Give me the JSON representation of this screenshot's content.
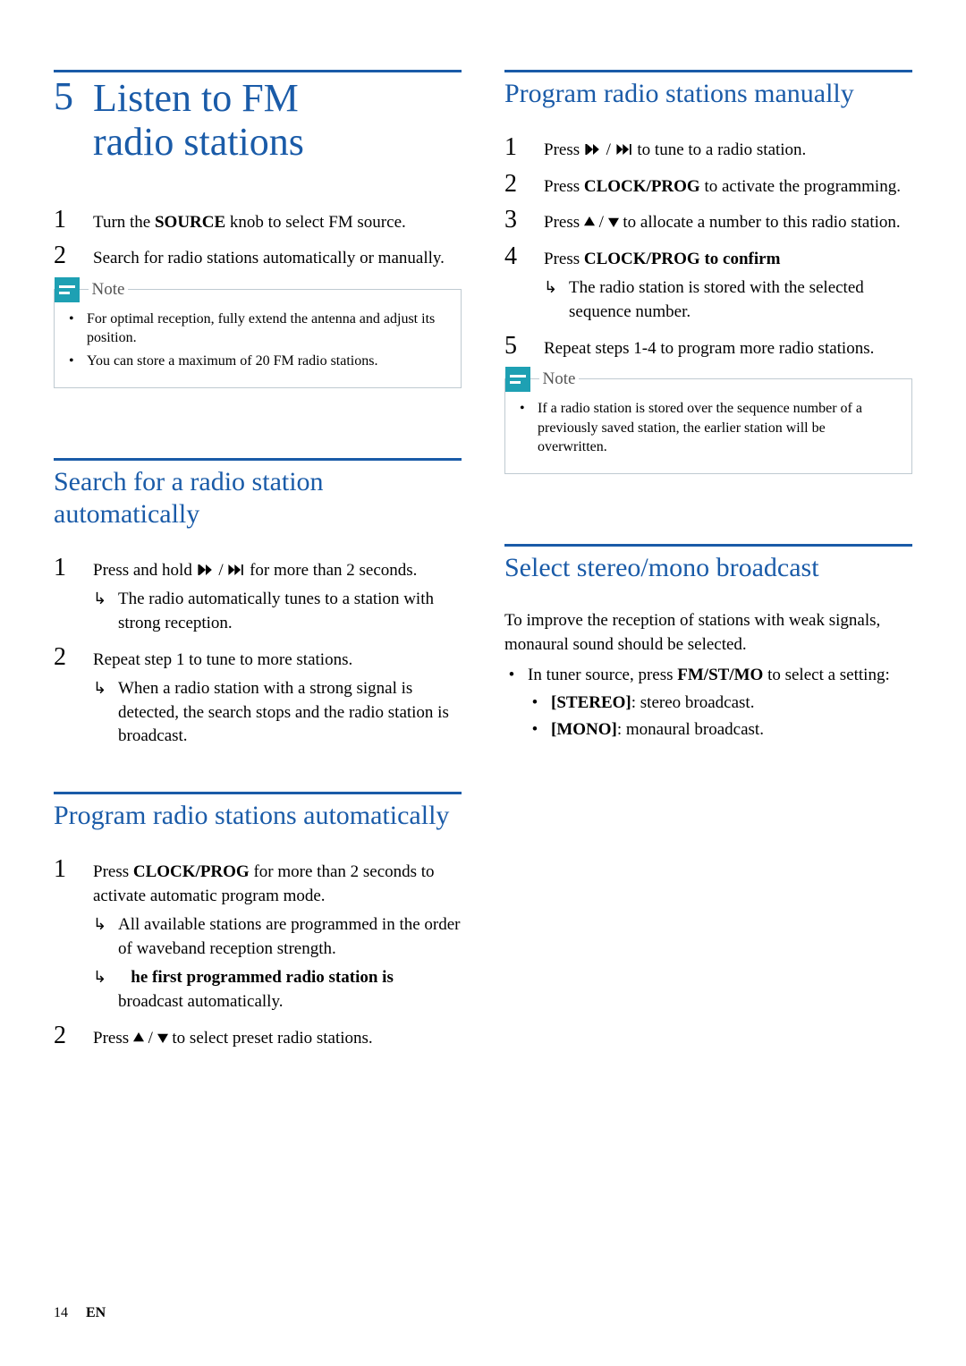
{
  "chapter": {
    "num": "5",
    "title_line1": "Listen to FM",
    "title_line2": "radio stations"
  },
  "intro_steps": {
    "s1_a": "Turn the ",
    "s1_b": "SOURCE",
    "s1_c": " knob to select FM source.",
    "s2": "Search for radio stations automatically or manually."
  },
  "note1": {
    "label": "Note",
    "items": [
      "For optimal reception, fully extend the antenna and adjust its position.",
      "You can store a maximum of 20 FM radio stations."
    ]
  },
  "sec_search_auto": {
    "title": "Search for a radio station automatically",
    "s1_a": "Press and hold ",
    "s1_b": " for more than 2 seconds.",
    "s1_res": "The radio automatically tunes to a station with strong reception.",
    "s2": "Repeat step 1 to tune to more stations.",
    "s2_res": "When a radio station with a strong signal is detected, the search stops and the radio station is broadcast."
  },
  "sec_prog_auto": {
    "title": "Program radio stations automatically",
    "s1_a": "Press ",
    "s1_b": "CLOCK/PROG",
    "s1_c": " for more than 2 seconds to activate automatic program mode.",
    "s1_res1": "All available stations are programmed in the order of waveband reception strength.",
    "s1_res2_a": "he first programmed radio station is",
    "s1_res2_b": " broadcast automatically.",
    "s2_a": "Press ",
    "s2_b": " to select preset radio stations."
  },
  "sec_prog_manual": {
    "title": "Program radio stations manually",
    "s1_a": "Press ",
    "s1_b": " to tune to a radio station.",
    "s2_a": "Press ",
    "s2_b": "CLOCK/PROG",
    "s2_c": " to activate the programming.",
    "s3_a": "Press ",
    "s3_b": " to allocate a number to this radio station.",
    "s4_a": "Press ",
    "s4_b": "CLOCK/PROG to confirm",
    "s4_res": "The radio station is stored with the selected sequence number.",
    "s5": "Repeat steps 1-4 to program more radio stations."
  },
  "note2": {
    "label": "Note",
    "items": [
      "If a radio station is stored over the sequence number of a previously saved station, the earlier station will be overwritten."
    ]
  },
  "sec_stereo": {
    "title": "Select stereo/mono broadcast",
    "intro": "To improve the reception of stations with weak signals, monaural sound should be selected.",
    "b1_a": "In tuner source, press ",
    "b1_b": "FM/ST/MO",
    "b1_c": " to select a setting:",
    "opt1_a": "[STEREO]",
    "opt1_b": ": stereo broadcast.",
    "opt2_a": "[MONO]",
    "opt2_b": ": monaural broadcast."
  },
  "footer": {
    "page": "14",
    "lang": "EN"
  }
}
